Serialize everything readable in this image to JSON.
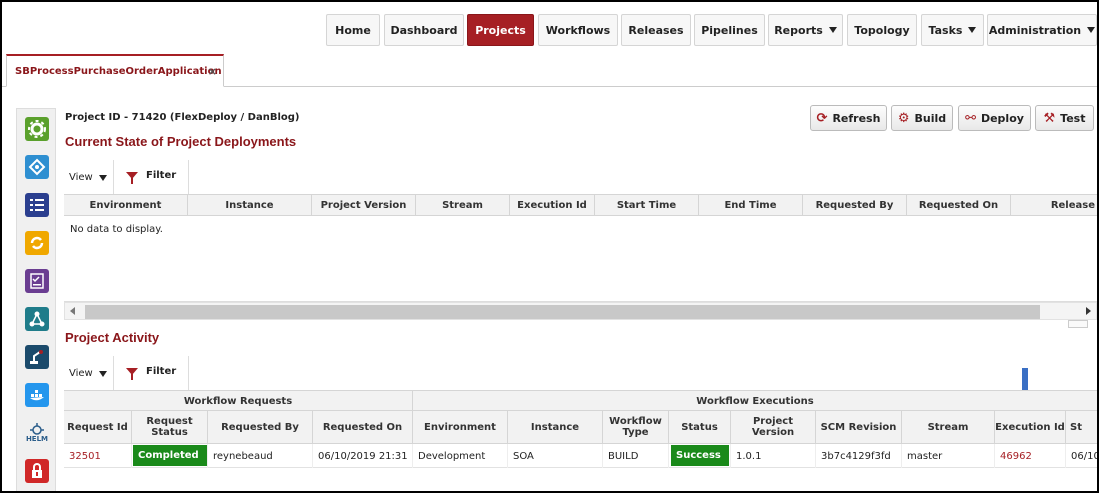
{
  "nav": {
    "items": [
      {
        "label": "Home"
      },
      {
        "label": "Dashboard"
      },
      {
        "label": "Projects",
        "active": true
      },
      {
        "label": "Workflows"
      },
      {
        "label": "Releases"
      },
      {
        "label": "Pipelines"
      },
      {
        "label": "Reports",
        "dropdown": true
      },
      {
        "label": "Topology"
      },
      {
        "label": "Tasks",
        "dropdown": true
      },
      {
        "label": "Administration",
        "dropdown": true
      }
    ],
    "accent": "#a61f24"
  },
  "tab": {
    "label": "SBProcessPurchaseOrderApplication",
    "close": "×"
  },
  "rail": {
    "icons": [
      "gear-icon",
      "integration-icon",
      "properties-icon",
      "sync-icon",
      "checklist-icon",
      "topology-icon",
      "robot-arm-icon",
      "docker-icon",
      "helm-icon",
      "lock-icon"
    ],
    "helm_text": "HELM"
  },
  "project": {
    "id_line": "Project ID - 71420 (FlexDeploy / DanBlog)",
    "current_state_title": "Current State of Project Deployments",
    "activity_title": "Project Activity"
  },
  "actions": {
    "refresh": "Refresh",
    "build": "Build",
    "deploy": "Deploy",
    "test": "Test"
  },
  "toolbar": {
    "view": "View",
    "filter": "Filter"
  },
  "deployments": {
    "headers": [
      "Environment",
      "Instance",
      "Project Version",
      "Stream",
      "Execution Id",
      "Start Time",
      "End Time",
      "Requested By",
      "Requested On",
      "Release"
    ],
    "empty_text": "No data to display."
  },
  "activity": {
    "groups": {
      "requests": "Workflow Requests",
      "executions": "Workflow Executions"
    },
    "headers": [
      "Request Id",
      "Request Status",
      "Requested By",
      "Requested On",
      "Environment",
      "Instance",
      "Workflow Type",
      "Status",
      "Project Version",
      "SCM Revision",
      "Stream",
      "Execution Id",
      "St"
    ],
    "rows": [
      {
        "request_id": "32501",
        "request_status": "Completed",
        "requested_by": "reynebeaud",
        "requested_on": "06/10/2019 21:31",
        "environment": "Development",
        "instance": "SOA",
        "workflow_type": "BUILD",
        "status": "Success",
        "project_version": "1.0.1",
        "scm_revision": "3b7c4129f3fd",
        "stream": "master",
        "execution_id": "46962",
        "start": "06/10"
      }
    ],
    "status_color": "#1a8a1a"
  }
}
